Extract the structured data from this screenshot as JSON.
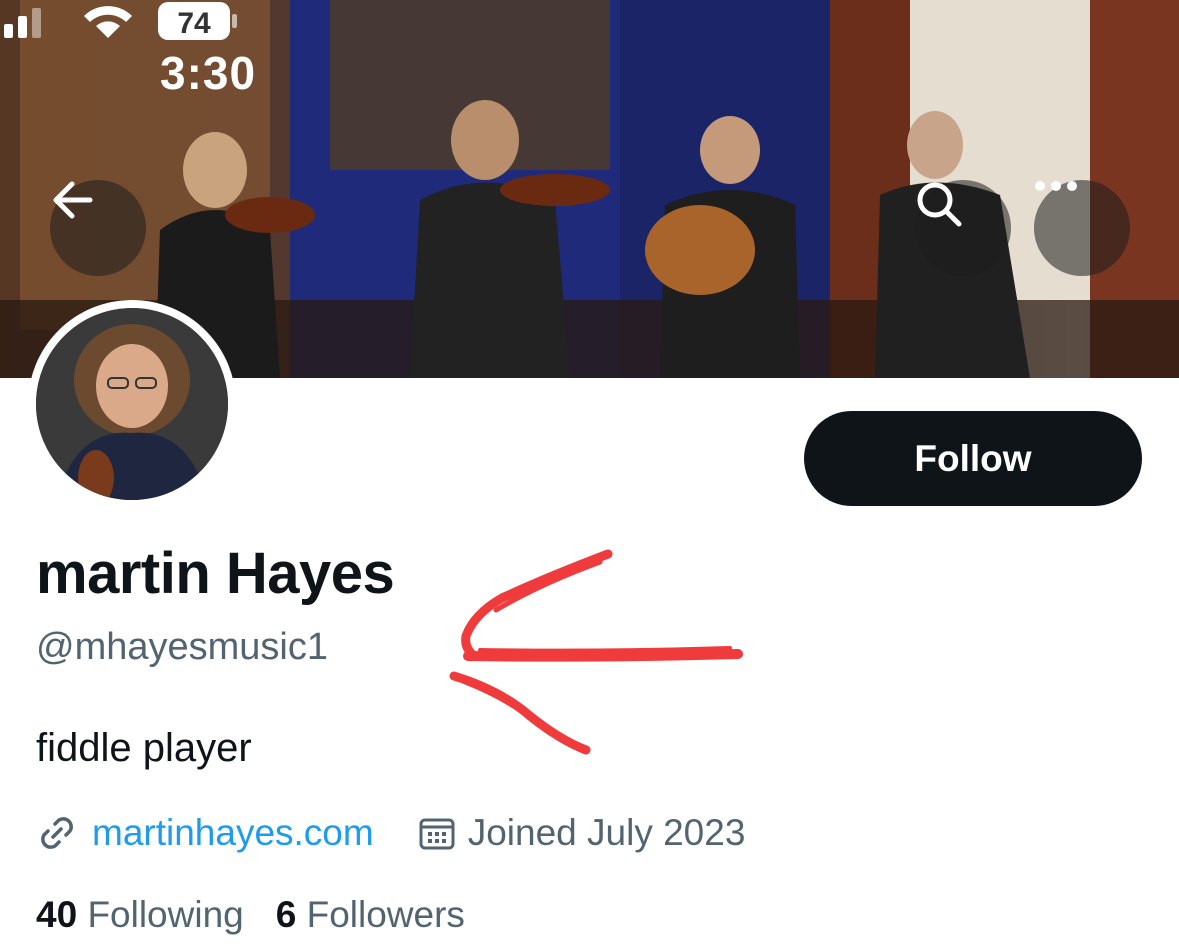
{
  "status_bar": {
    "time": "3:30",
    "battery": "74",
    "icons": [
      "signal-icon",
      "wifi-icon",
      "battery-icon"
    ]
  },
  "header": {
    "back_icon": "arrow-left-icon",
    "search_icon": "search-icon",
    "more_icon": "more-horizontal-icon"
  },
  "profile": {
    "display_name": "martin Hayes",
    "handle": "@mhayesmusic1",
    "bio": "fiddle player",
    "website": "martinhayes.com",
    "joined": "Joined July 2023",
    "following_count": "40",
    "following_label": "Following",
    "followers_count": "6",
    "followers_label": "Followers"
  },
  "actions": {
    "follow_label": "Follow"
  },
  "colors": {
    "primary_text": "#0f1419",
    "secondary_text": "#536471",
    "link": "#1d9bf0",
    "annotation": "#ee2b2b"
  }
}
